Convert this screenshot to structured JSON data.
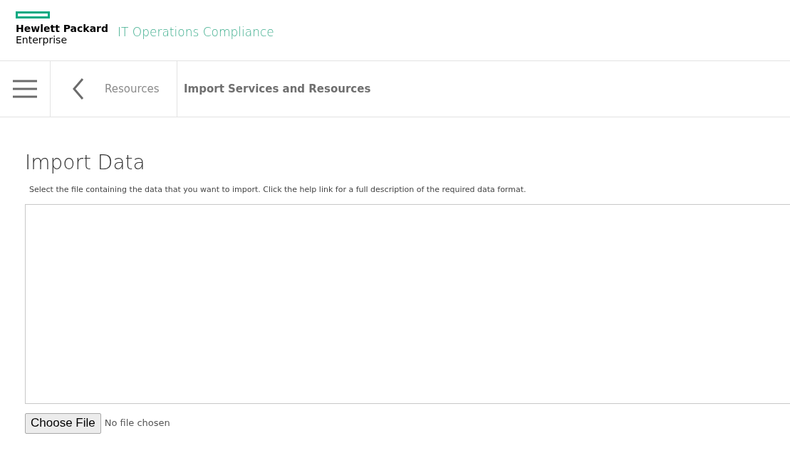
{
  "header": {
    "brand_line_1": "Hewlett Packard",
    "brand_line_2": "Enterprise",
    "product": "IT Operations Compliance"
  },
  "nav": {
    "breadcrumb": "Resources",
    "current": "Import Services and Resources"
  },
  "page": {
    "title": "Import Data",
    "description": "Select the file containing the data that you want to import. Click the help link for a full description of the required data format."
  },
  "file_input": {
    "button": "Choose File",
    "status": "No file chosen"
  }
}
